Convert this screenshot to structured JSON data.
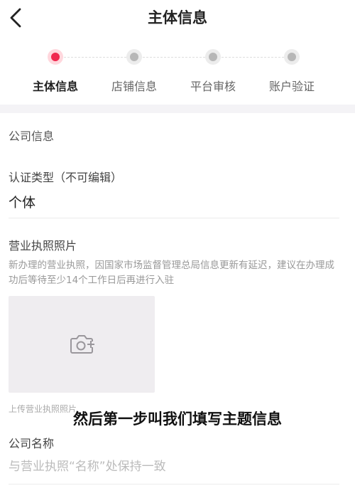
{
  "header": {
    "title": "主体信息"
  },
  "steps": [
    {
      "label": "主体信息",
      "active": true
    },
    {
      "label": "店铺信息",
      "active": false
    },
    {
      "label": "平台审核",
      "active": false
    },
    {
      "label": "账户验证",
      "active": false
    }
  ],
  "form": {
    "section_title": "公司信息",
    "cert_type_label": "认证类型（不可编辑）",
    "cert_type_value": "个体",
    "license_label": "营业执照照片",
    "license_hint": "新办理的营业执照，因国家市场监督管理总局信息更新有延迟，建议在办理成功后等待至少14个工作日后再进行入驻",
    "upload_caption": "上传营业执照照片",
    "company_name_label": "公司名称",
    "company_name_placeholder": "与营业执照“名称”处保持一致"
  },
  "video_subtitle": "然后第一步叫我们填写主题信息",
  "icons": {
    "back": "chevron-left-icon",
    "camera": "camera-plus-icon"
  },
  "colors": {
    "accent": "#f0284f",
    "inactive_dot": "#b7b7b7",
    "band": "#f4f3f6"
  }
}
